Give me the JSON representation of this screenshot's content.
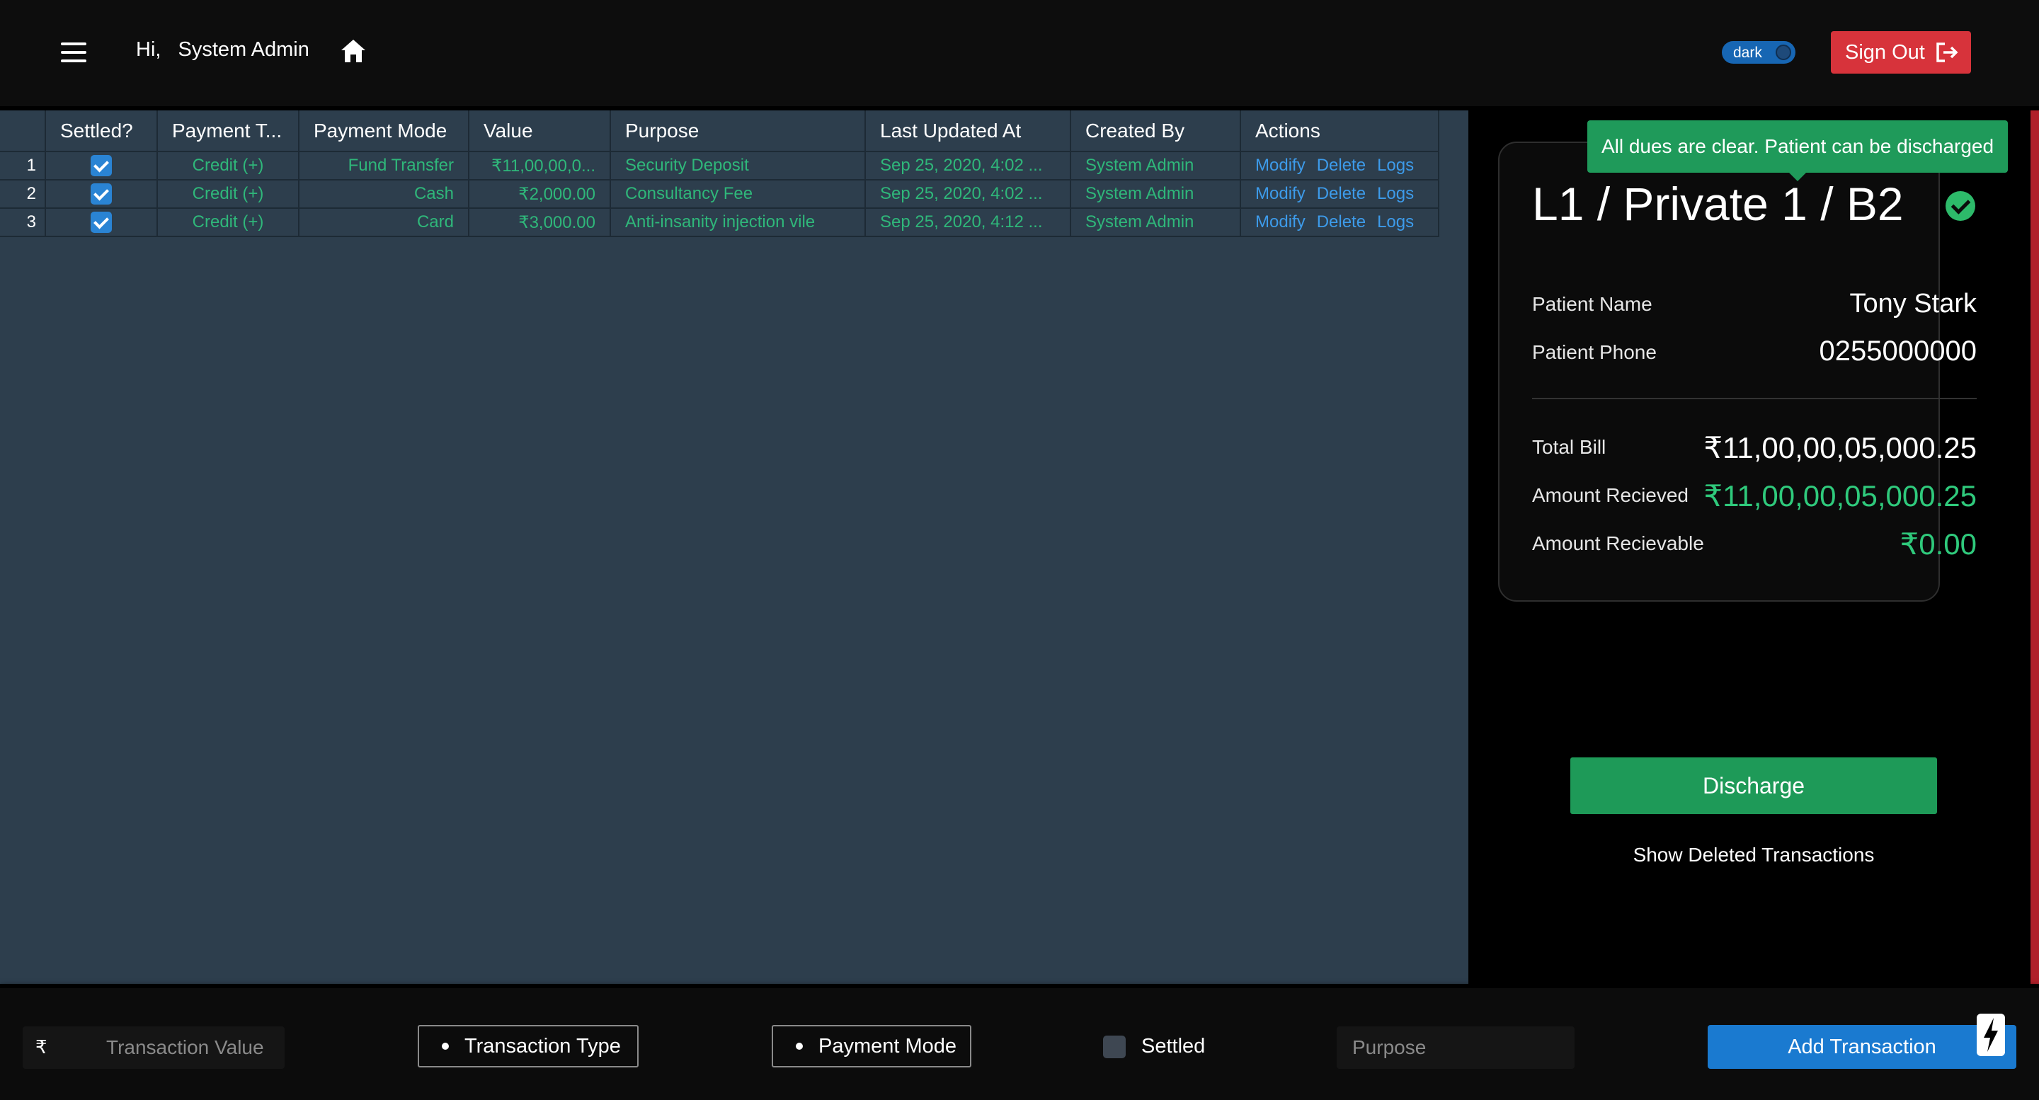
{
  "header": {
    "hi": "Hi,",
    "user_name": "System Admin",
    "theme_label": "dark",
    "signout_label": "Sign Out"
  },
  "table": {
    "columns": [
      "Settled?",
      "Payment T...",
      "Payment Mode",
      "Value",
      "Purpose",
      "Last Updated At",
      "Created By",
      "Actions"
    ],
    "rows": [
      {
        "index": "1",
        "settled": true,
        "payment_type": "Credit (+)",
        "payment_mode": "Fund Transfer",
        "value": "₹11,00,00,0...",
        "purpose": "Security Deposit",
        "updated": "Sep 25, 2020, 4:02 ...",
        "created_by": "System Admin"
      },
      {
        "index": "2",
        "settled": true,
        "payment_type": "Credit (+)",
        "payment_mode": "Cash",
        "value": "₹2,000.00",
        "purpose": "Consultancy Fee",
        "updated": "Sep 25, 2020, 4:02 ...",
        "created_by": "System Admin"
      },
      {
        "index": "3",
        "settled": true,
        "payment_type": "Credit (+)",
        "payment_mode": "Card",
        "value": "₹3,000.00",
        "purpose": "Anti-insanity injection vile",
        "updated": "Sep 25, 2020, 4:12 ...",
        "created_by": "System Admin"
      }
    ],
    "actions": [
      "Modify",
      "Delete",
      "Logs"
    ]
  },
  "summary": {
    "tooltip": "All dues are clear. Patient can be discharged",
    "room": "L1 / Private 1 / B2",
    "patient_name_label": "Patient Name",
    "patient_name": "Tony Stark",
    "patient_phone_label": "Patient Phone",
    "patient_phone": "0255000000",
    "total_bill_label": "Total Bill",
    "total_bill": "₹11,00,00,05,000.25",
    "amount_received_label": "Amount Recieved",
    "amount_received": "₹11,00,00,05,000.25",
    "amount_receivable_label": "Amount Recievable",
    "amount_receivable": "₹0.00",
    "discharge_label": "Discharge",
    "show_deleted_label": "Show Deleted Transactions"
  },
  "form": {
    "currency_symbol": "₹",
    "transaction_value_placeholder": "Transaction Value",
    "transaction_type_label": "Transaction Type",
    "payment_mode_label": "Payment Mode",
    "settled_label": "Settled",
    "purpose_placeholder": "Purpose",
    "add_label": "Add Transaction"
  },
  "colors": {
    "accent_green": "#2fca7c",
    "link_blue": "#3d9bea",
    "signout_red": "#d7333b",
    "primary_blue": "#1a7ad0"
  }
}
